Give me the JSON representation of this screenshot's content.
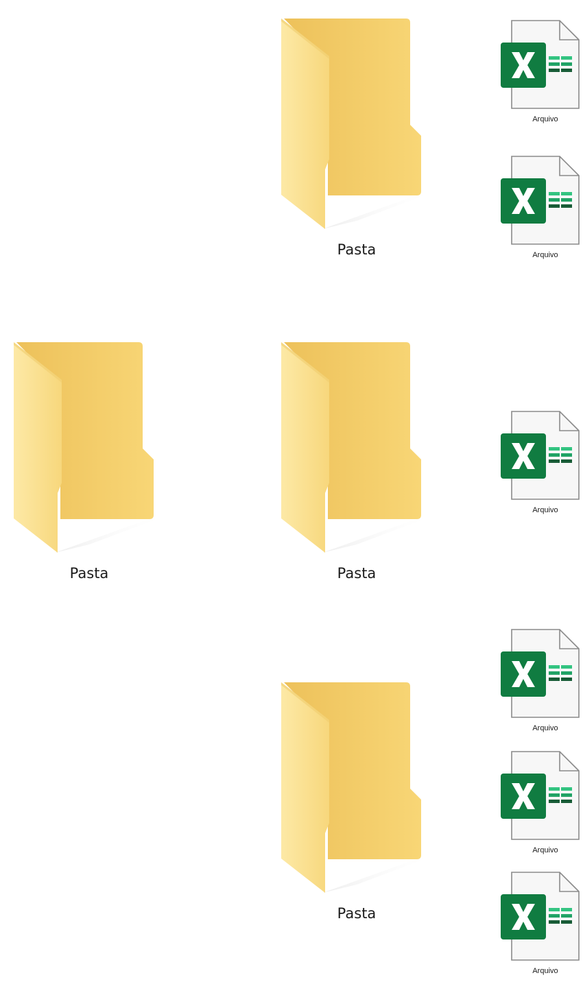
{
  "folders": [
    {
      "label": "Pasta",
      "icon": "folder-icon"
    },
    {
      "label": "Pasta",
      "icon": "folder-icon"
    },
    {
      "label": "Pasta",
      "icon": "folder-icon"
    },
    {
      "label": "Pasta",
      "icon": "folder-icon"
    }
  ],
  "files": [
    {
      "label": "Arquivo",
      "icon": "excel-file-icon",
      "badge_letter": "X"
    },
    {
      "label": "Arquivo",
      "icon": "excel-file-icon",
      "badge_letter": "X"
    },
    {
      "label": "Arquivo",
      "icon": "excel-file-icon",
      "badge_letter": "X"
    },
    {
      "label": "Arquivo",
      "icon": "excel-file-icon",
      "badge_letter": "X"
    },
    {
      "label": "Arquivo",
      "icon": "excel-file-icon",
      "badge_letter": "X"
    },
    {
      "label": "Arquivo",
      "icon": "excel-file-icon",
      "badge_letter": "X"
    }
  ],
  "colors": {
    "folder_back": "#F3C95E",
    "folder_front": "#FBE08C",
    "excel_green": "#107C41",
    "excel_light_green": "#33C481",
    "excel_dark_green": "#185C37"
  }
}
